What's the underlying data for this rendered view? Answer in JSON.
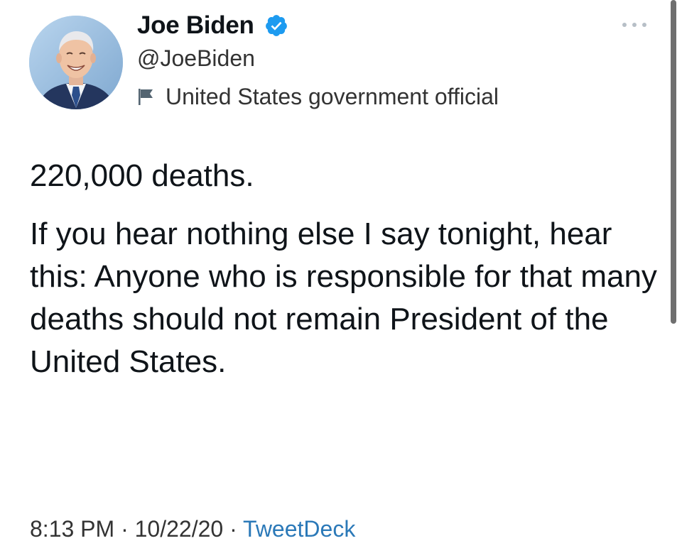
{
  "author": {
    "display_name": "Joe Biden",
    "handle": "@JoeBiden",
    "label": "United States government official",
    "verified": true,
    "avatar": "joe-biden-avatar",
    "verified_icon": "verified-badge-icon",
    "label_icon": "flag-icon",
    "more_icon": "more-options-icon"
  },
  "tweet": {
    "paragraphs": [
      "220,000 deaths.",
      "If you hear nothing else I say tonight, hear this: Anyone who is responsible for that many deaths should not remain President of the United States."
    ]
  },
  "meta": {
    "time": "8:13 PM",
    "separator": " · ",
    "date": "10/22/20",
    "source": "TweetDeck"
  },
  "colors": {
    "verified_blue": "#1d9bf0",
    "source_link": "#2b79b8",
    "text": "#0f1419",
    "secondary_text": "#333333"
  }
}
